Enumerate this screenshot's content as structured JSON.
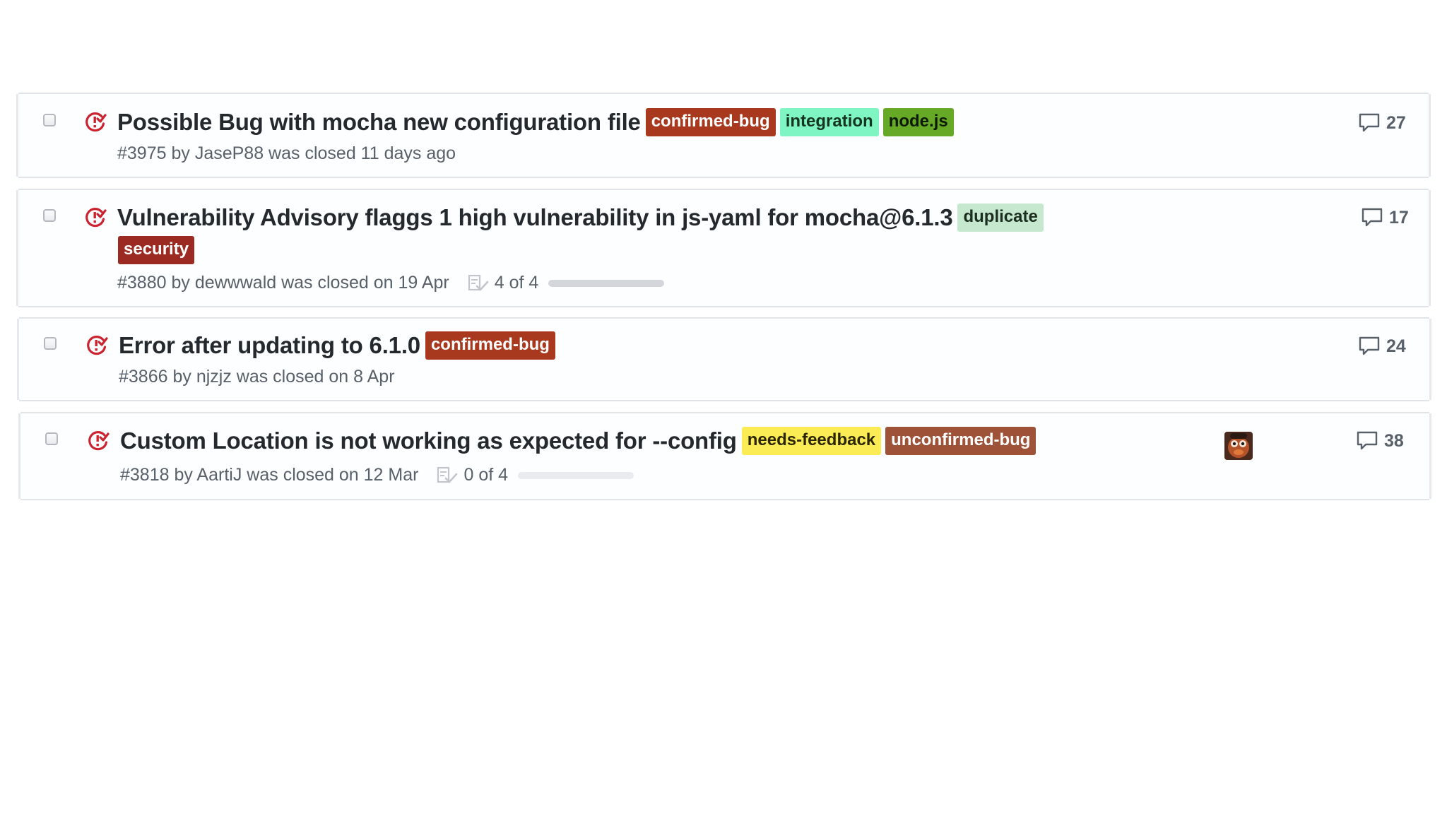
{
  "issues": [
    {
      "title": "Possible Bug with mocha new configuration file",
      "labels": [
        {
          "name": "confirmed-bug",
          "bg": "#a8391f",
          "fg": "#ffffff"
        },
        {
          "name": "integration",
          "bg": "#7ff5c4",
          "fg": "#16341f"
        },
        {
          "name": "node.js",
          "bg": "#66a926",
          "fg": "#0d1a06"
        }
      ],
      "meta": "#3975 by JaseP88 was closed 11 days ago",
      "tasks": null,
      "comments": "27",
      "has_avatar": false
    },
    {
      "title": "Vulnerability Advisory flaggs 1 high vulnerability in js-yaml for mocha@6.1.3",
      "labels": [
        {
          "name": "duplicate",
          "bg": "#c5e8cf",
          "fg": "#1b2e20"
        },
        {
          "name": "security",
          "bg": "#9b2b22",
          "fg": "#ffffff"
        }
      ],
      "meta": "#3880 by dewwwald was closed on 19 Apr",
      "tasks": {
        "text": "4 of 4",
        "fraction": 1.0
      },
      "comments": "17",
      "has_avatar": false
    },
    {
      "title": "Error after updating to 6.1.0",
      "labels": [
        {
          "name": "confirmed-bug",
          "bg": "#a8391f",
          "fg": "#ffffff"
        }
      ],
      "meta": "#3866 by njzjz was closed on 8 Apr",
      "tasks": null,
      "comments": "24",
      "has_avatar": false
    },
    {
      "title": "Custom Location is not working as expected for --config",
      "labels": [
        {
          "name": "needs-feedback",
          "bg": "#fbec55",
          "fg": "#2b2600"
        },
        {
          "name": "unconfirmed-bug",
          "bg": "#9e5237",
          "fg": "#ffffff"
        }
      ],
      "meta": "#3818 by AartiJ was closed on 12 Mar",
      "tasks": {
        "text": "0 of 4",
        "fraction": 0.0
      },
      "comments": "38",
      "has_avatar": true
    }
  ],
  "colors": {
    "closed_icon": "#cb2431",
    "row_border": "#e1e4e8",
    "muted_text": "#586069"
  },
  "icons": {
    "state": "issue-closed-icon",
    "tasks": "checklist-icon",
    "comments": "comment-icon",
    "select": "checkbox"
  }
}
